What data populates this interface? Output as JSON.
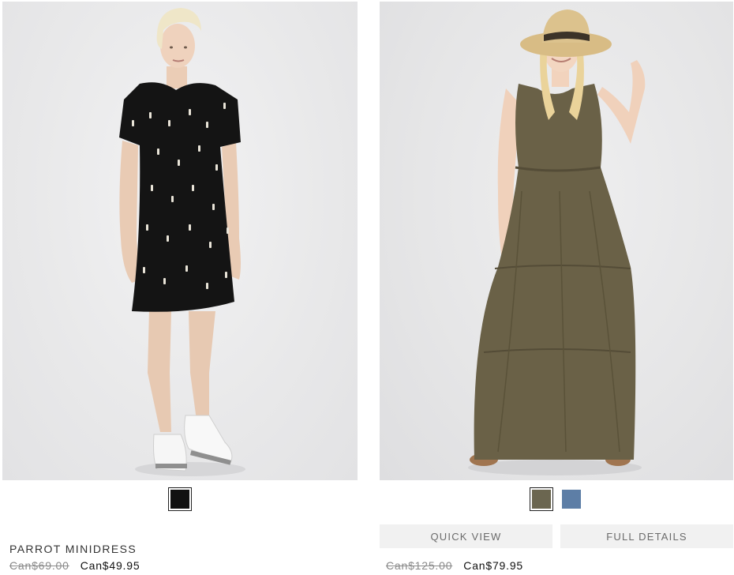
{
  "products": [
    {
      "name": "PARROT MINIDRESS",
      "old_price": "Can$69.00",
      "new_price": "Can$49.95",
      "image_alt": "Model wearing black parrot print T-shirt dress",
      "swatches": [
        {
          "color": "#111111",
          "selected": true
        }
      ]
    },
    {
      "name": "",
      "old_price": "Can$125.00",
      "new_price": "Can$79.95",
      "image_alt": "Model wearing olive tiered maxi dress and straw hat",
      "swatches": [
        {
          "color": "#6b6650",
          "selected": true
        },
        {
          "color": "#5d7ea6",
          "selected": false
        }
      ],
      "quick_view_label": "QUICK VIEW",
      "full_details_label": "FULL DETAILS"
    }
  ]
}
